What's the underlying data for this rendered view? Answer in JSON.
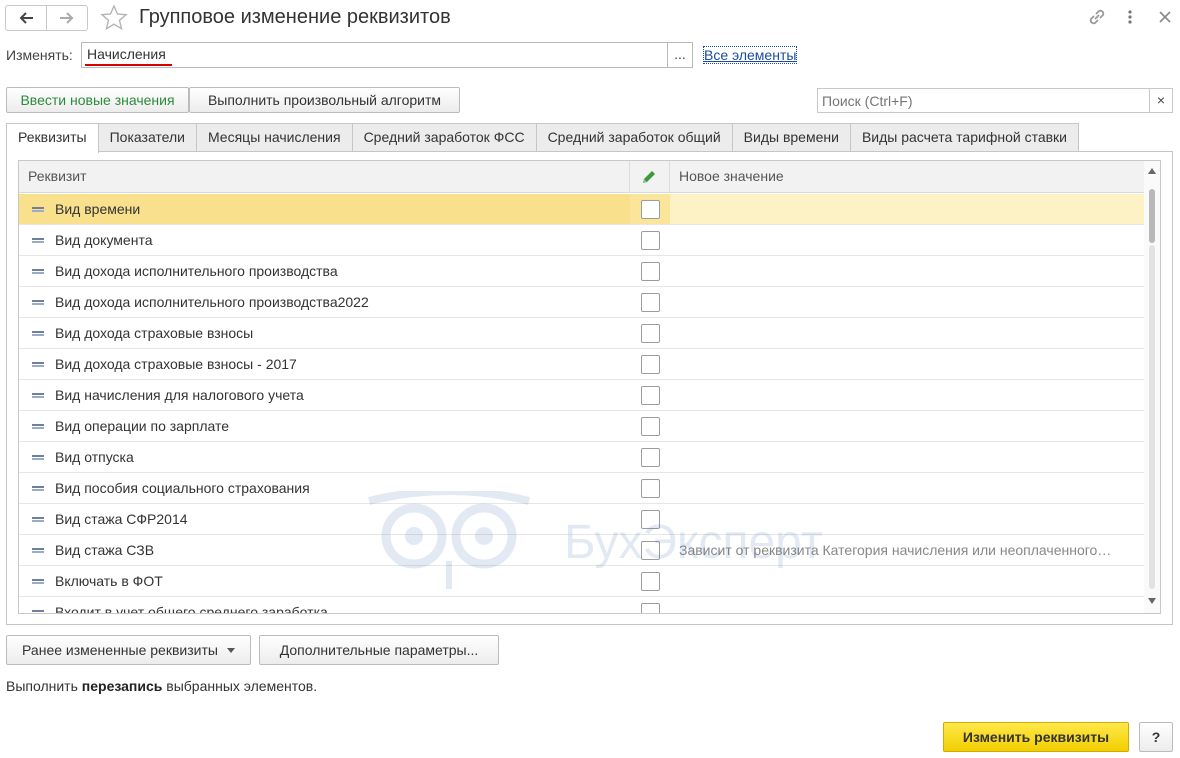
{
  "window": {
    "title": "Групповое изменение реквизитов",
    "back_icon": "arrow-left-icon",
    "forward_icon": "arrow-right-icon",
    "favorite_icon": "star-icon",
    "link_icon": "link-icon",
    "menu_icon": "more-vertical-icon",
    "close_icon": "close-icon"
  },
  "change": {
    "label": "Изменять:",
    "value": "Начисления",
    "select_button": "...",
    "all_elements_link": "Все элементы"
  },
  "toolbar": {
    "enter_new_values": "Ввести новые значения",
    "run_algorithm": "Выполнить произвольный алгоритм",
    "search_placeholder": "Поиск (Ctrl+F)",
    "search_clear": "×"
  },
  "tabs": [
    {
      "label": "Реквизиты",
      "active": true
    },
    {
      "label": "Показатели"
    },
    {
      "label": "Месяцы начисления"
    },
    {
      "label": "Средний заработок ФСС"
    },
    {
      "label": "Средний заработок общий"
    },
    {
      "label": "Виды времени"
    },
    {
      "label": "Виды расчета тарифной ставки"
    }
  ],
  "table": {
    "columns": {
      "attribute": "Реквизит",
      "edit_icon": "pencil-icon",
      "new_value": "Новое значение"
    },
    "rows": [
      {
        "name": "Вид времени",
        "checked": false,
        "value": "",
        "selected": true
      },
      {
        "name": "Вид документа",
        "checked": false,
        "value": ""
      },
      {
        "name": "Вид дохода исполнительного производства",
        "checked": false,
        "value": ""
      },
      {
        "name": "Вид дохода исполнительного производства2022",
        "checked": false,
        "value": ""
      },
      {
        "name": "Вид дохода страховые взносы",
        "checked": false,
        "value": ""
      },
      {
        "name": "Вид дохода страховые взносы - 2017",
        "checked": false,
        "value": ""
      },
      {
        "name": "Вид начисления для налогового учета",
        "checked": false,
        "value": ""
      },
      {
        "name": "Вид операции по зарплате",
        "checked": false,
        "value": ""
      },
      {
        "name": "Вид отпуска",
        "checked": false,
        "value": ""
      },
      {
        "name": "Вид пособия социального страхования",
        "checked": false,
        "value": ""
      },
      {
        "name": "Вид стажа  СФР2014",
        "checked": false,
        "value": ""
      },
      {
        "name": "Вид стажа СЗВ",
        "checked": false,
        "value": "Зависит от реквизита Категория начисления или неоплаченного…"
      },
      {
        "name": "Включать в ФОТ",
        "checked": false,
        "value": ""
      },
      {
        "name": "Входит в учет общего среднего заработка",
        "checked": false,
        "value": ""
      }
    ]
  },
  "watermark": "БухЭксперт",
  "bottom": {
    "previously_changed": "Ранее измененные реквизиты",
    "additional_params": "Дополнительные параметры...",
    "hint_prefix": "Выполнить ",
    "hint_bold": "перезапись",
    "hint_suffix": " выбранных элементов.",
    "submit": "Изменить реквизиты",
    "help": "?"
  },
  "colors": {
    "selected_row": "#fbe59a",
    "primary_button": "#f2cf00",
    "link": "#1a4da1",
    "green_text": "#2c8a3c"
  }
}
